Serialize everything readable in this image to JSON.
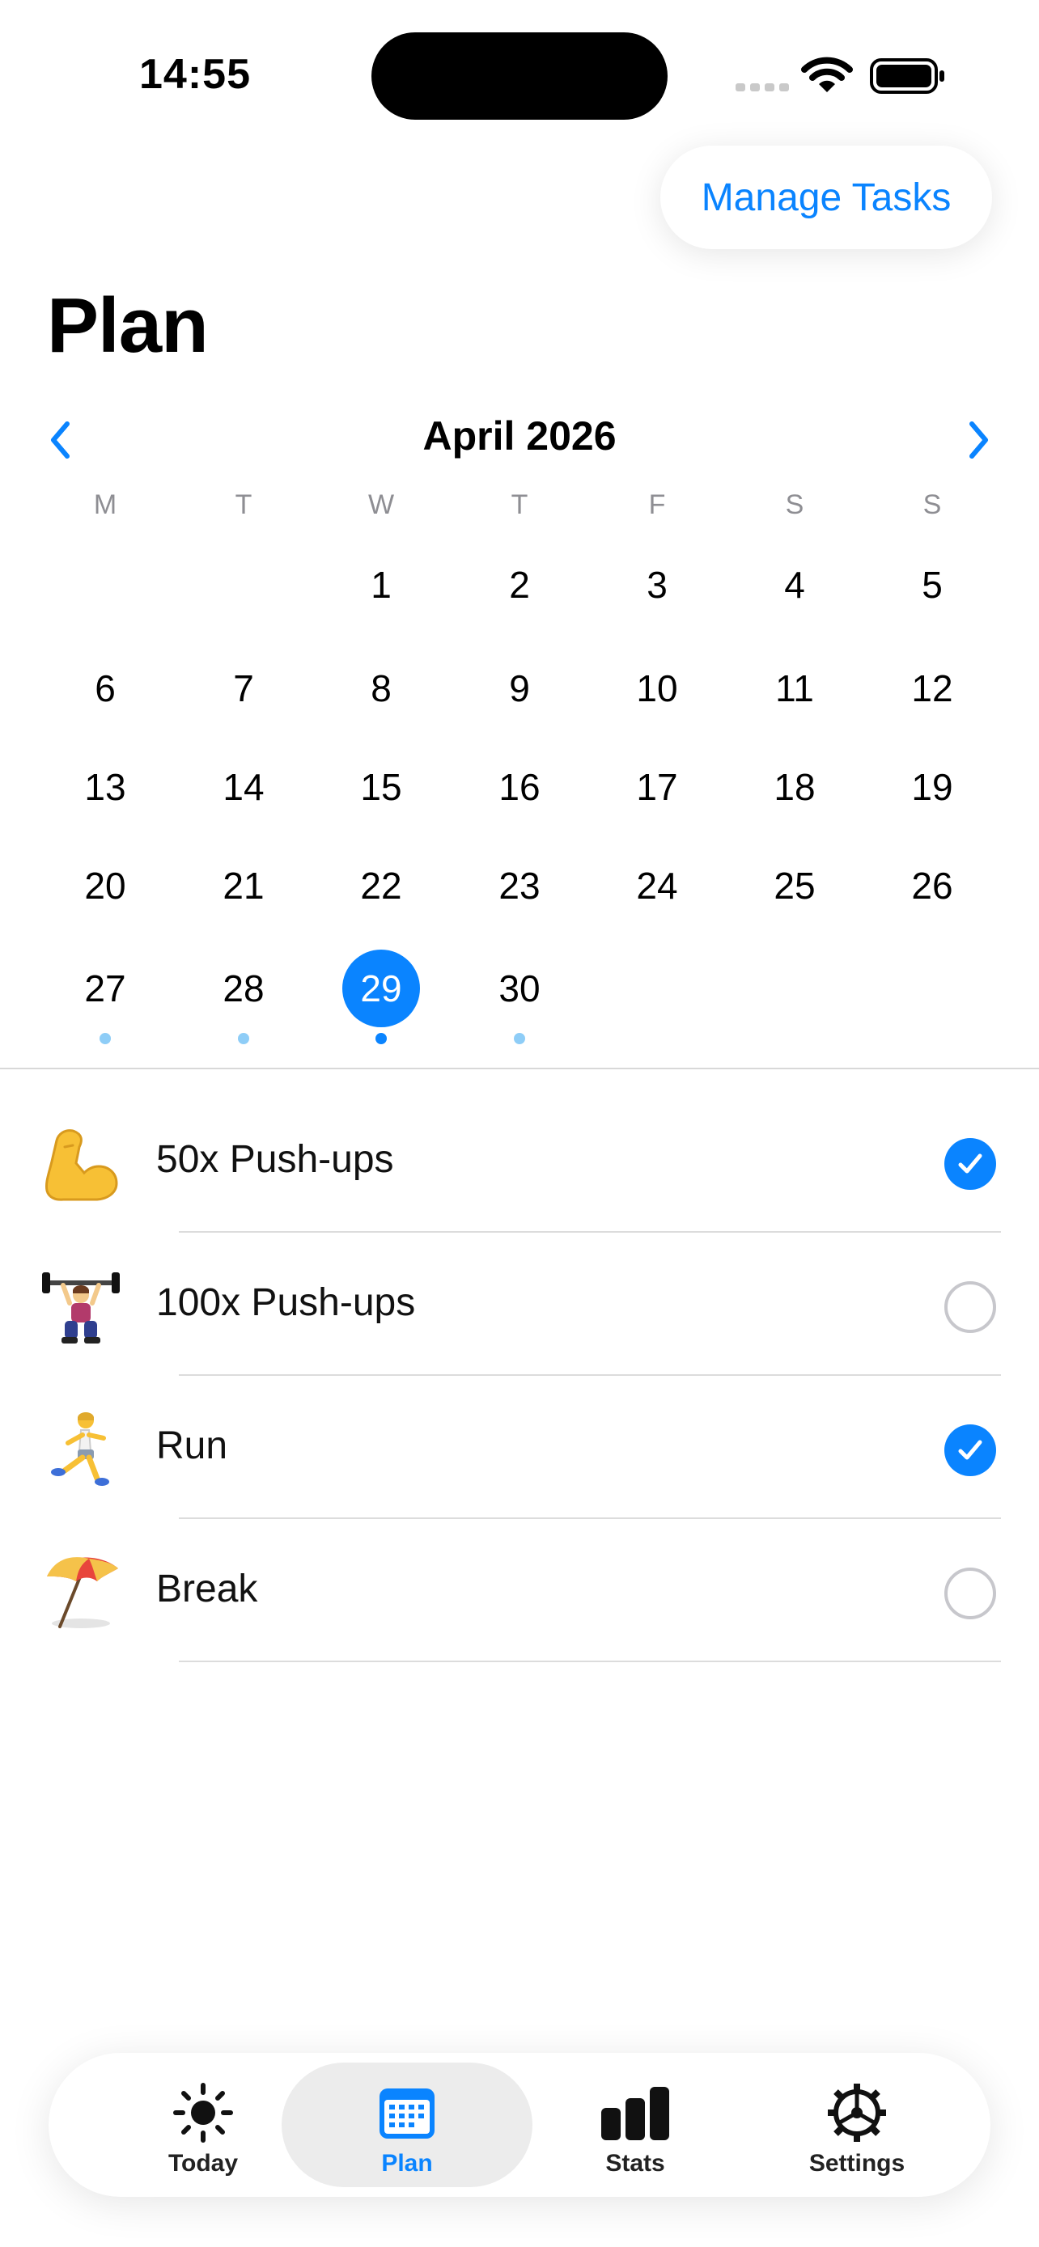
{
  "status_bar": {
    "time": "14:55"
  },
  "header": {
    "manage_label": "Manage Tasks",
    "title": "Plan"
  },
  "calendar": {
    "month_label": "April 2026",
    "weekdays": [
      "M",
      "T",
      "W",
      "T",
      "F",
      "S",
      "S"
    ],
    "weeks": [
      [
        "",
        "",
        "1",
        "2",
        "3",
        "4",
        "5"
      ],
      [
        "6",
        "7",
        "8",
        "9",
        "10",
        "11",
        "12"
      ],
      [
        "13",
        "14",
        "15",
        "16",
        "17",
        "18",
        "19"
      ],
      [
        "20",
        "21",
        "22",
        "23",
        "24",
        "25",
        "26"
      ],
      [
        "27",
        "28",
        "29",
        "30",
        "",
        "",
        ""
      ]
    ],
    "selected_day": "29",
    "days_with_tasks": [
      "27",
      "28",
      "29",
      "30"
    ]
  },
  "tasks": [
    {
      "emoji": "flexed-biceps",
      "label": "50x Push-ups",
      "done": true
    },
    {
      "emoji": "weight-lifter",
      "label": "100x Push-ups",
      "done": false
    },
    {
      "emoji": "runner",
      "label": "Run",
      "done": true
    },
    {
      "emoji": "beach-umbrella",
      "label": "Break",
      "done": false
    }
  ],
  "tab_bar": {
    "tabs": [
      {
        "label": "Today",
        "icon": "sun-icon",
        "active": false
      },
      {
        "label": "Plan",
        "icon": "calendar-icon",
        "active": true
      },
      {
        "label": "Stats",
        "icon": "bar-chart-icon",
        "active": false
      },
      {
        "label": "Settings",
        "icon": "gear-icon",
        "active": false
      }
    ]
  },
  "colors": {
    "accent": "#0a84ff",
    "event_dot": "#8ecdf7"
  }
}
